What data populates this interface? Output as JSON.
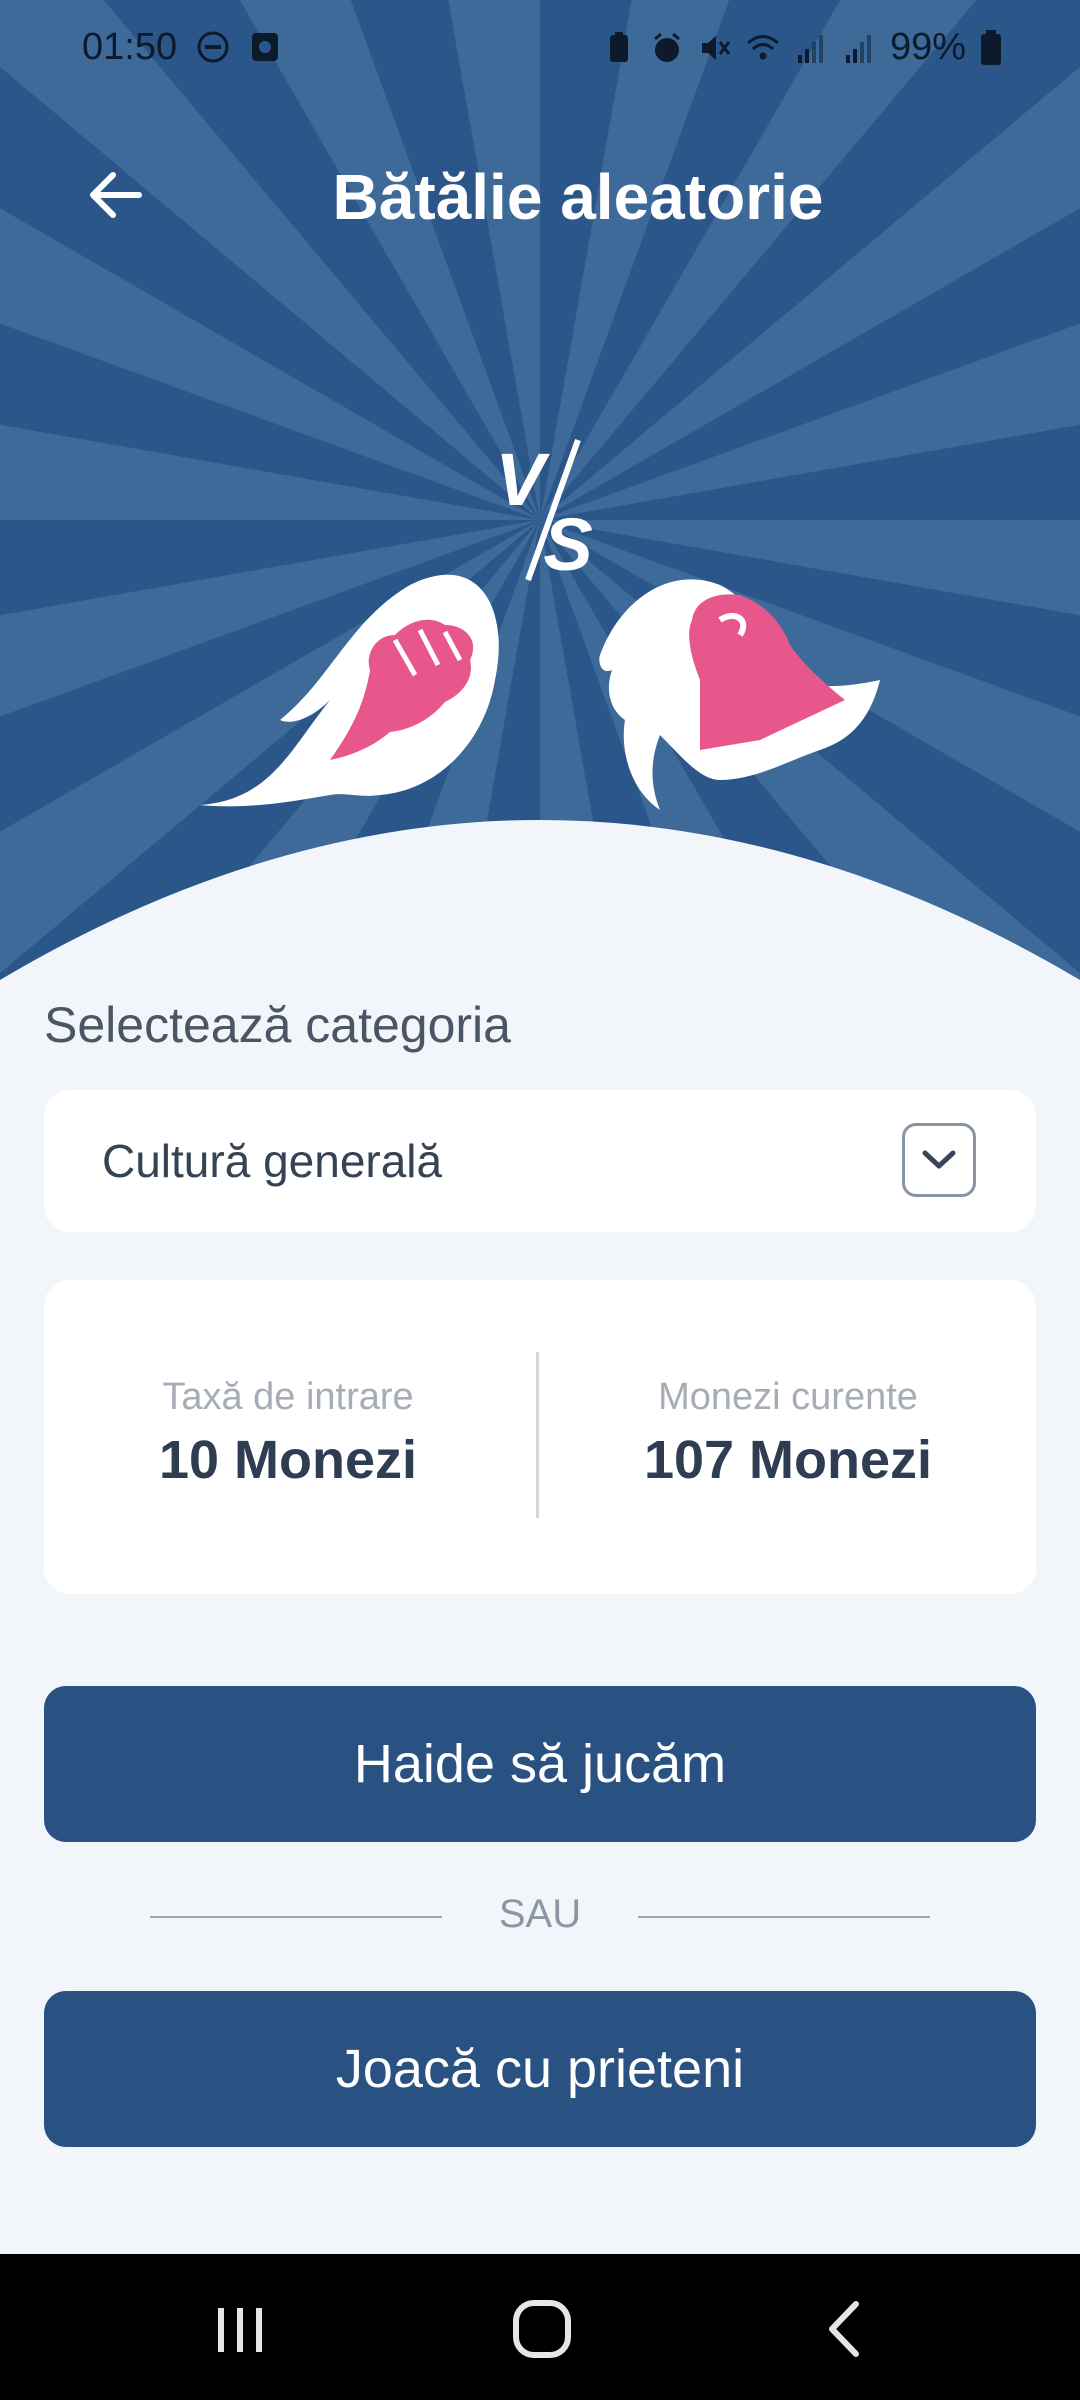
{
  "status_bar": {
    "time": "01:50",
    "battery": "99%",
    "left_icons": [
      "dnd-icon",
      "screen-record-icon"
    ],
    "right_icons": [
      "battery-saver-icon",
      "alarm-icon",
      "mute-icon",
      "wifi-icon",
      "signal-icon",
      "signal-icon-2",
      "battery-icon"
    ]
  },
  "header": {
    "title": "Bătălie aleatorie",
    "back_icon": "arrow-left-icon",
    "vs_text": "VS"
  },
  "category": {
    "label": "Selectează categoria",
    "selected": "Cultură generală",
    "chevron_icon": "chevron-down-icon"
  },
  "info": {
    "entry_fee_label": "Taxă de intrare",
    "entry_fee_value": "10 Monezi",
    "current_coins_label": "Monezi curente",
    "current_coins_value": "107 Monezi"
  },
  "actions": {
    "play_label": "Haide să jucăm",
    "or_label": "SAU",
    "friends_label": "Joacă cu prieteni"
  },
  "nav": {
    "recents_icon": "recents-icon",
    "home_icon": "home-icon",
    "back_icon": "back-chevron-icon"
  },
  "colors": {
    "hero_bg": "#2b5689",
    "button_bg": "#295283",
    "accent_pink": "#e8578b",
    "page_bg": "#f2f6fa"
  }
}
